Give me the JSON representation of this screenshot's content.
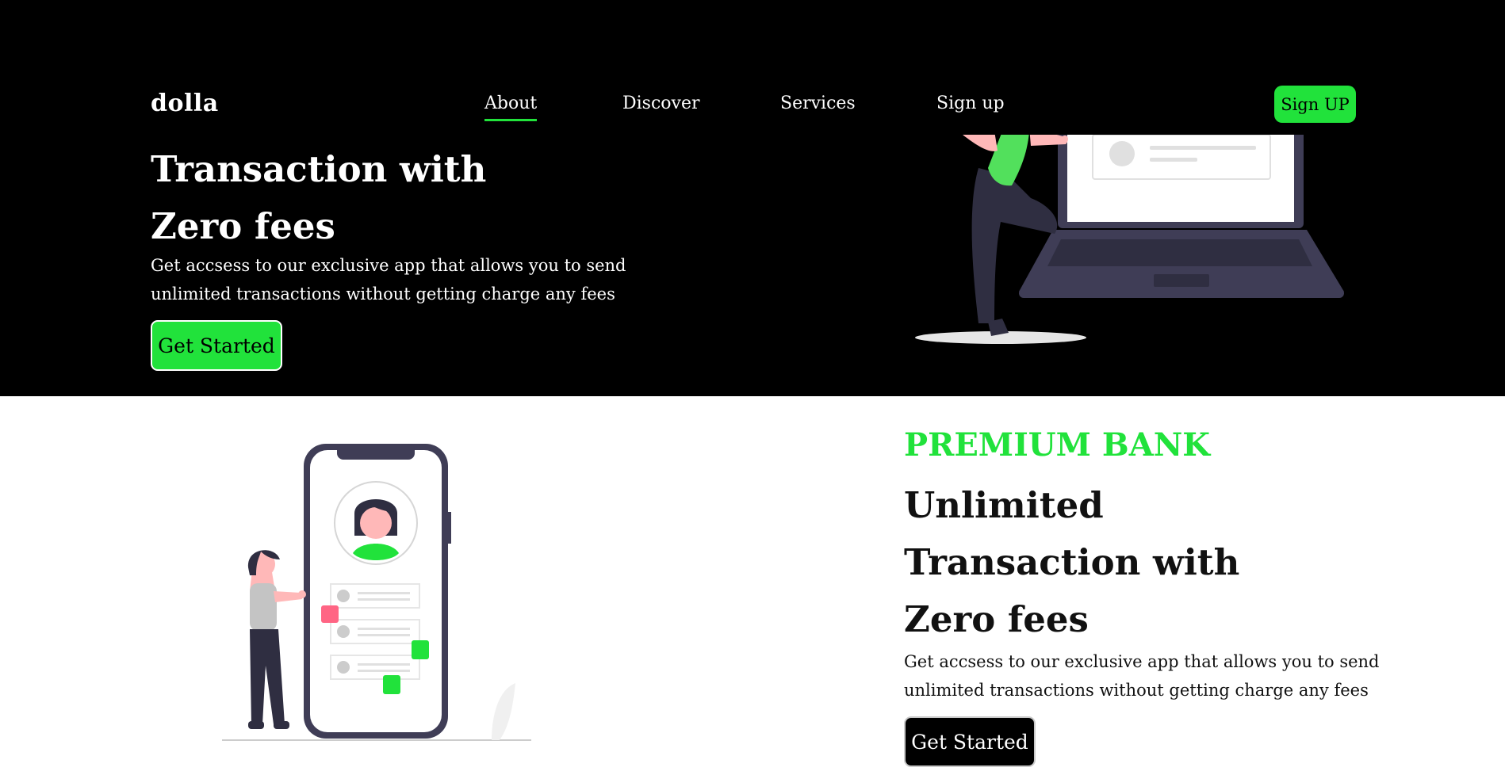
{
  "nav": {
    "logo": "dolla",
    "links": [
      {
        "label": "About",
        "active": true
      },
      {
        "label": "Discover",
        "active": false
      },
      {
        "label": "Services",
        "active": false
      },
      {
        "label": "Sign up",
        "active": false
      }
    ],
    "cta": "Sign UP"
  },
  "hero": {
    "title_line1": "Transaction with",
    "title_line2": "Zero fees",
    "description_line1": "Get accsess to our exclusive app that allows you to send",
    "description_line2": "unlimited transactions without getting charge any fees",
    "button": "Get Started",
    "illustration_icon": "person-with-laptop-illustration"
  },
  "section2": {
    "eyebrow": "PREMIUM BANK",
    "title_line1": "Unlimited",
    "title_line2": "Transaction with",
    "title_line3": "Zero fees",
    "description_line1": "Get accsess to our exclusive app that allows you to send",
    "description_line2": "unlimited transactions without getting charge any fees",
    "button": "Get Started",
    "illustration_icon": "person-with-phone-illustration"
  },
  "colors": {
    "accent": "#21e23b",
    "dark": "#000000",
    "illustration_dark": "#3f3d56",
    "skin": "#ffb8b8",
    "pink": "#ff6584"
  }
}
